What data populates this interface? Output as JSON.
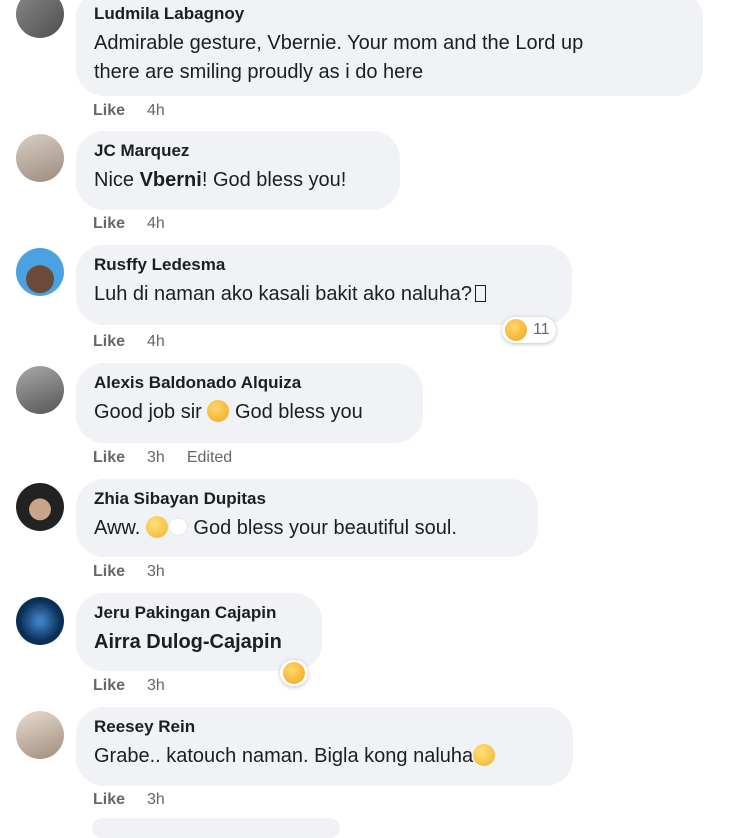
{
  "comments": [
    {
      "author": "Ludmila Labagnoy",
      "line1": "Admirable gesture, Vbernie. Your mom and the Lord up",
      "line2": "there are smiling proudly as i do here",
      "like": "Like",
      "time": "4h",
      "avatar_color": "#6a6a6a"
    },
    {
      "author": "JC Marquez",
      "text_pre": "Nice ",
      "text_bold": "Vberni",
      "text_post": "! God bless you!",
      "like": "Like",
      "time": "4h",
      "avatar_color": "#b9a89a"
    },
    {
      "author": "Rusffy Ledesma",
      "text": "Luh di naman ako kasali bakit ako naluha?",
      "like": "Like",
      "time": "4h",
      "reaction_count": "11",
      "avatar_color": "#4aa3e0"
    },
    {
      "author": "Alexis Baldonado Alquiza",
      "text_pre": "Good job sir ",
      "text_post": " God bless you",
      "like": "Like",
      "time": "3h",
      "edited": "Edited",
      "avatar_color": "#7b7b7b"
    },
    {
      "author": "Zhia Sibayan Dupitas",
      "text_pre": "Aww. ",
      "text_post": " God bless your beautiful soul.",
      "like": "Like",
      "time": "3h",
      "avatar_color": "#3a3a3a"
    },
    {
      "author": "Jeru Pakingan Cajapin",
      "text": "Airra Dulog-Cajapin",
      "like": "Like",
      "time": "3h",
      "avatar_color": "#0d3a6b"
    },
    {
      "author": "Reesey Rein",
      "text": "Grabe.. katouch naman. Bigla kong naluha",
      "like": "Like",
      "time": "3h",
      "avatar_color": "#c9b8a8"
    }
  ]
}
